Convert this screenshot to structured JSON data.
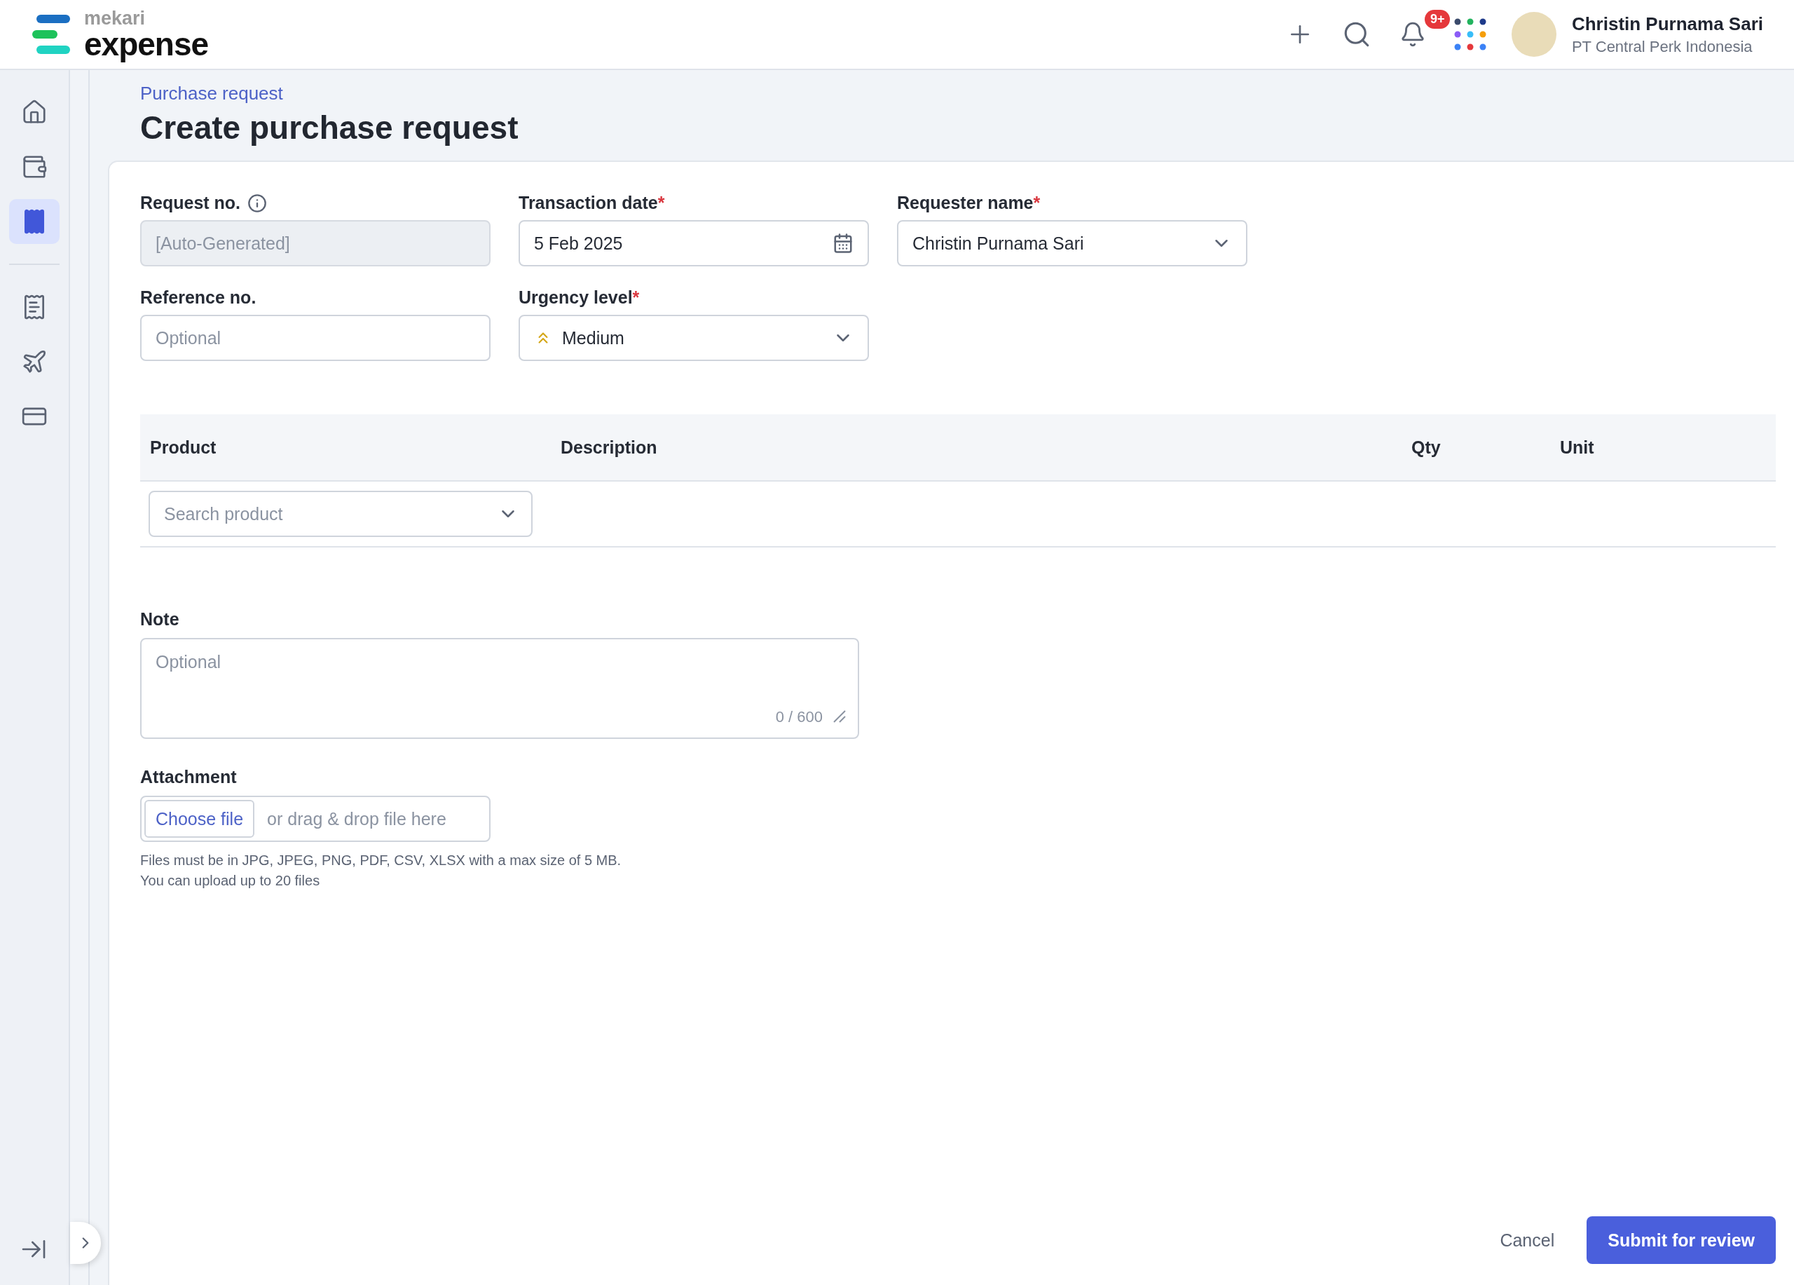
{
  "header": {
    "logo_top": "mekari",
    "logo_bottom": "expense",
    "notification_count": "9+",
    "user": {
      "name": "Christin Purnama Sari",
      "company": "PT Central Perk Indonesia"
    }
  },
  "sidebar": {
    "items": [
      {
        "selected": false
      },
      {
        "selected": false
      },
      {
        "selected": true
      }
    ],
    "items_lower": [
      {
        "selected": false
      },
      {
        "selected": false
      },
      {
        "selected": false
      }
    ]
  },
  "breadcrumb": "Purchase request",
  "title": "Create purchase request",
  "fields": [
    {
      "label": "Request no.",
      "kind": "readonly",
      "info": true,
      "placeholder": "[Auto-Generated]"
    },
    {
      "label": "Transaction date",
      "kind": "date",
      "required_mark": "*",
      "value": "5 Feb 2025"
    },
    {
      "label": "Requester name",
      "kind": "select",
      "required_mark": "*",
      "value": "Christin Purnama Sari"
    },
    {
      "label": "Reference no.",
      "kind": "text",
      "placeholder": "Optional"
    },
    {
      "label": "Urgency level",
      "kind": "urgency",
      "required_mark": "*",
      "value": "Medium",
      "color": "#d4a617"
    }
  ],
  "table": {
    "columns": [
      "Product",
      "Description",
      "Qty",
      "Unit"
    ],
    "product_placeholder": "Search product"
  },
  "note": {
    "label": "Note",
    "placeholder": "Optional",
    "counter": "0 / 600"
  },
  "attachment": {
    "label": "Attachment",
    "button": "Choose file",
    "hint": "or drag & drop file here",
    "help": [
      "Files must be in JPG, JPEG, PNG, PDF, CSV, XLSX with a max size of 5 MB.",
      "You can upload up to 20 files"
    ]
  },
  "actions": {
    "cancel": "Cancel",
    "submit": "Submit for review"
  }
}
